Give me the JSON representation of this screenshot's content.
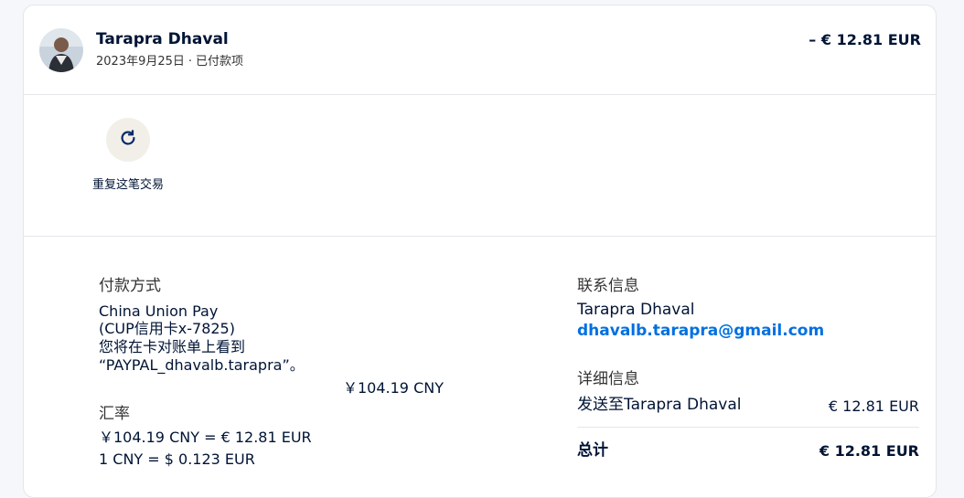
{
  "header": {
    "name": "Tarapra Dhaval",
    "date": "2023年9月25日",
    "status": "已付款项",
    "amount": "– € 12.81 EUR"
  },
  "actions": {
    "repeat_label": "重复这笔交易"
  },
  "payment": {
    "heading": "付款方式",
    "method_line1": "China Union Pay",
    "method_line2": "(CUP信用卡x-7825)",
    "note_line1": "您将在卡对账单上看到",
    "note_line2": "“PAYPAL_dhavalb.tarapra”。",
    "amount_cny": "￥104.19 CNY"
  },
  "exchange": {
    "heading": "汇率",
    "line1": "￥104.19 CNY = € 12.81 EUR",
    "line2": "1 CNY = $ 0.123 EUR"
  },
  "contact": {
    "heading": "联系信息",
    "name": "Tarapra Dhaval",
    "email": "dhavalb.tarapra@gmail.com"
  },
  "details": {
    "heading": "详细信息",
    "sent_to_label": "发送至Tarapra Dhaval",
    "sent_to_amount": "€ 12.81 EUR",
    "total_label": "总计",
    "total_amount": "€ 12.81 EUR"
  },
  "icons": {
    "avatar": "avatar",
    "repeat": "refresh-icon"
  }
}
